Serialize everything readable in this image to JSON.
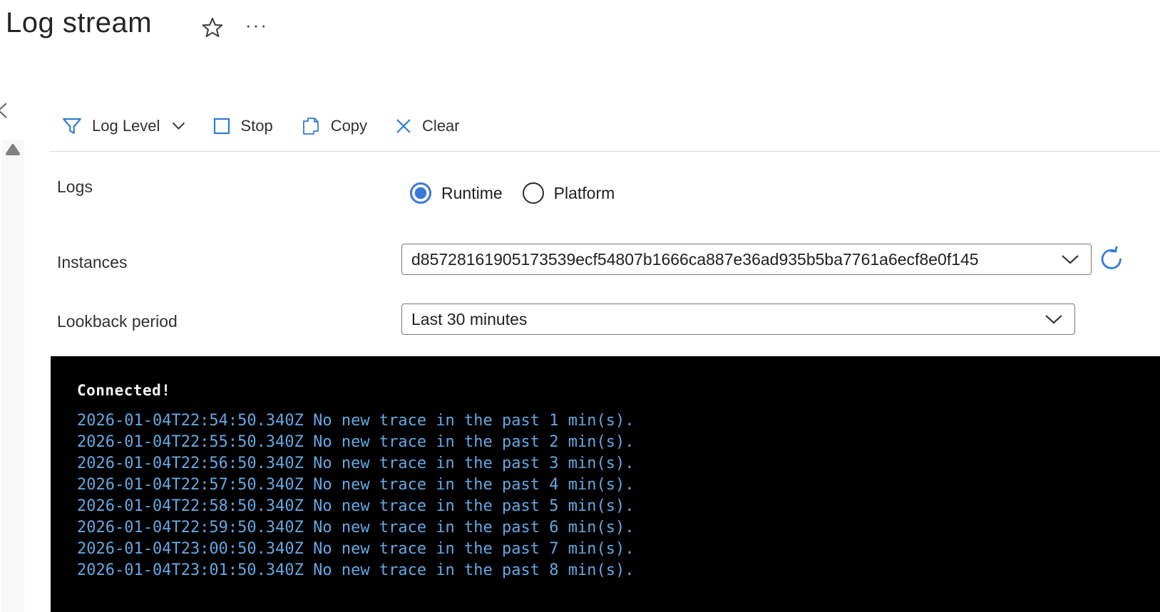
{
  "page": {
    "title": "Log stream"
  },
  "header": {
    "favorite_icon": "star-outline",
    "more_icon": "ellipsis"
  },
  "toolbar": {
    "log_level": {
      "label": "Log Level",
      "icon": "filter-funnel",
      "has_dropdown": true
    },
    "stop": {
      "label": "Stop",
      "icon": "stop-square"
    },
    "copy": {
      "label": "Copy",
      "icon": "copy-pages"
    },
    "clear": {
      "label": "Clear",
      "icon": "clear-x"
    }
  },
  "form": {
    "logs": {
      "label": "Logs",
      "options": [
        {
          "label": "Runtime",
          "selected": true
        },
        {
          "label": "Platform",
          "selected": false
        }
      ]
    },
    "instances": {
      "label": "Instances",
      "value": "d85728161905173539ecf54807b1666ca887e36ad935b5ba7761a6ecf8e0f145",
      "refresh_icon": "refresh-circular-arrow"
    },
    "lookback": {
      "label": "Lookback period",
      "value": "Last 30 minutes"
    }
  },
  "console": {
    "status": "Connected!",
    "lines": [
      "2026-01-04T22:54:50.340Z No new trace in the past 1 min(s).",
      "2026-01-04T22:55:50.340Z No new trace in the past 2 min(s).",
      "2026-01-04T22:56:50.340Z No new trace in the past 3 min(s).",
      "2026-01-04T22:57:50.340Z No new trace in the past 4 min(s).",
      "2026-01-04T22:58:50.340Z No new trace in the past 5 min(s).",
      "2026-01-04T22:59:50.340Z No new trace in the past 6 min(s).",
      "2026-01-04T23:00:50.340Z No new trace in the past 7 min(s).",
      "2026-01-04T23:01:50.340Z No new trace in the past 8 min(s)."
    ],
    "colors": {
      "background": "#000000",
      "status_text": "#f5f5f5",
      "line_text": "#64a8e2"
    }
  },
  "colors": {
    "accent_blue": "#2e7cd6",
    "radio_selected": "#3b78d8",
    "text_dark": "#323130",
    "divider": "#d6d6d6",
    "rail_background": "#f8f8f8"
  }
}
